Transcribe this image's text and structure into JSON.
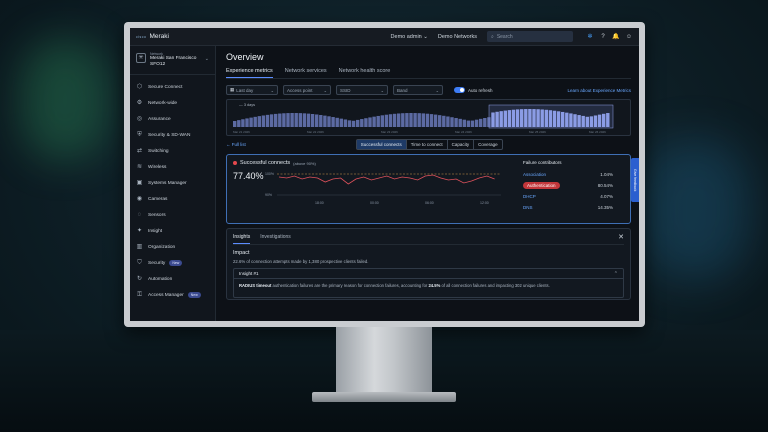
{
  "topbar": {
    "cisco": "cisco",
    "brand": "Meraki",
    "org": "Demo admin",
    "org_chevron": "⌄",
    "network": "Demo Networks",
    "search_placeholder": "Search"
  },
  "network": {
    "label": "Network",
    "name_line1": "Meraki San Francisco",
    "name_line2": "SFO12"
  },
  "sidebar": {
    "items": [
      {
        "label": "Secure Connect",
        "icon": "secure-connect-icon",
        "badge": ""
      },
      {
        "label": "Network-wide",
        "icon": "network-wide-icon",
        "badge": ""
      },
      {
        "label": "Assurance",
        "icon": "assurance-icon",
        "badge": ""
      },
      {
        "label": "Security & SD-WAN",
        "icon": "security-sdwan-icon",
        "badge": ""
      },
      {
        "label": "Switching",
        "icon": "switching-icon",
        "badge": ""
      },
      {
        "label": "Wireless",
        "icon": "wireless-icon",
        "badge": ""
      },
      {
        "label": "Systems Manager",
        "icon": "systems-manager-icon",
        "badge": ""
      },
      {
        "label": "Cameras",
        "icon": "cameras-icon",
        "badge": ""
      },
      {
        "label": "Sensors",
        "icon": "sensors-icon",
        "badge": ""
      },
      {
        "label": "Insight",
        "icon": "insight-icon",
        "badge": ""
      },
      {
        "label": "Organization",
        "icon": "organization-icon",
        "badge": ""
      },
      {
        "label": "Security",
        "icon": "security-icon",
        "badge": "New"
      },
      {
        "label": "Automation",
        "icon": "automation-icon",
        "badge": ""
      },
      {
        "label": "Access Manager",
        "icon": "access-manager-icon",
        "badge": "New"
      }
    ]
  },
  "main": {
    "title": "Overview",
    "tabs": [
      "Experience metrics",
      "Network services",
      "Network health score"
    ],
    "filters": {
      "time": "Last day",
      "access_point": "Access point",
      "ssid": "SSID",
      "band": "Band",
      "auto_refresh": "Auto refresh",
      "learn": "Learn about Experience Metrics"
    },
    "timeline": {
      "label": "— 3 days",
      "dates": [
        "Mar 21 2026",
        "Mar 22 2026",
        "Mar 23 2026",
        "Mar 24 2026",
        "Mar 25 2026",
        "Mar 26 2026"
      ]
    },
    "full_list": "← Full list",
    "segments": [
      "Successful connects",
      "Time to connect",
      "Capacity",
      "Coverage"
    ]
  },
  "card": {
    "title": "Successful connects",
    "subtitle": "(above 90%)",
    "value": "77.40%",
    "y_top": "100%",
    "y_mid": "90%",
    "x_labels": [
      "18:00",
      "00:00",
      "06:00",
      "12:00"
    ],
    "failure_title": "Failure contributors",
    "failures": [
      {
        "name": "Association",
        "value": "1.04%",
        "alert": false
      },
      {
        "name": "Authentication",
        "value": "80.54%",
        "alert": true
      },
      {
        "name": "DHCP",
        "value": "4.07%",
        "alert": false
      },
      {
        "name": "DNS",
        "value": "14.35%",
        "alert": false
      }
    ]
  },
  "insights": {
    "tabs": [
      "Insights",
      "Investigations"
    ],
    "close": "✕",
    "impact_title": "Impact",
    "impact_text": "22.6% of connection attempts made by 1,380 prospective clients failed.",
    "insight_title": "Insight #1",
    "chevron": "⌃",
    "body_strong1": "RADIUS timeout",
    "body_text1": " authentication failures are the primary reason for connection failures, accounting for ",
    "body_strong2": "24.5%",
    "body_text2": " of all connection failures and impacting 302 unique clients."
  },
  "feedback": "Give feedback",
  "colors": {
    "accent": "#5b8cff",
    "link": "#6aa8ff",
    "alert": "#c2363a",
    "threshold": "#d49a4a",
    "series": "#e0525c"
  }
}
